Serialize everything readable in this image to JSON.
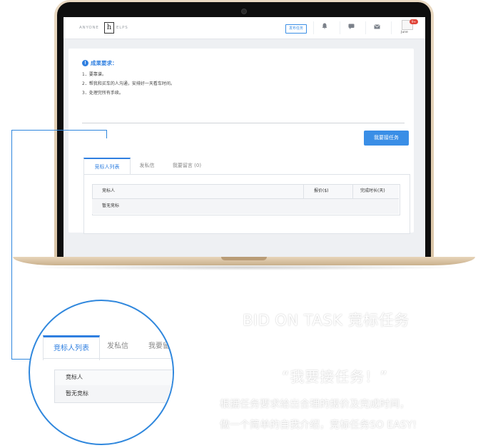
{
  "header": {
    "logo_left": "ANYONE",
    "logo_mark": "h",
    "logo_right": "ELPS",
    "publish_button": "发布任务",
    "bell_icon": "bell-icon",
    "chat_icon": "chat-icon",
    "mail_icon": "mail-icon",
    "avatar_badge": "9+",
    "user_name": "June"
  },
  "requirements": {
    "title": "成果要求：",
    "items": [
      "1．要靠谱。",
      "2．帮我和买车的人沟通，安排好一天看车时间。",
      "3．处理完所有手续。"
    ]
  },
  "bid_button": "我要接任务",
  "tabs": [
    {
      "label": "竞标人列表",
      "active": true
    },
    {
      "label": "发私信",
      "active": false
    },
    {
      "label": "我要留言 (0)",
      "active": false
    }
  ],
  "table": {
    "columns": [
      "竞标人",
      "报价($)",
      "完成时长(天)"
    ],
    "empty_text": "暂无竞标"
  },
  "zoom": {
    "tabs": [
      "竞标人列表",
      "发私信",
      "我要留言"
    ],
    "column": "竞标人",
    "empty_text": "暂无竞标"
  },
  "promo": {
    "title": "BID ON TASK 竞标任务",
    "quote": "“我要接任务！”",
    "line1": "根据任务要求给出合理的报价及完成时间，",
    "line2": "做一个简单的自我介绍，竞标任务SO EASY!"
  },
  "colors": {
    "accent": "#2f7fe0",
    "button": "#3a8ee6",
    "badge": "#e0463b",
    "laptop": "#d9c4a6"
  }
}
